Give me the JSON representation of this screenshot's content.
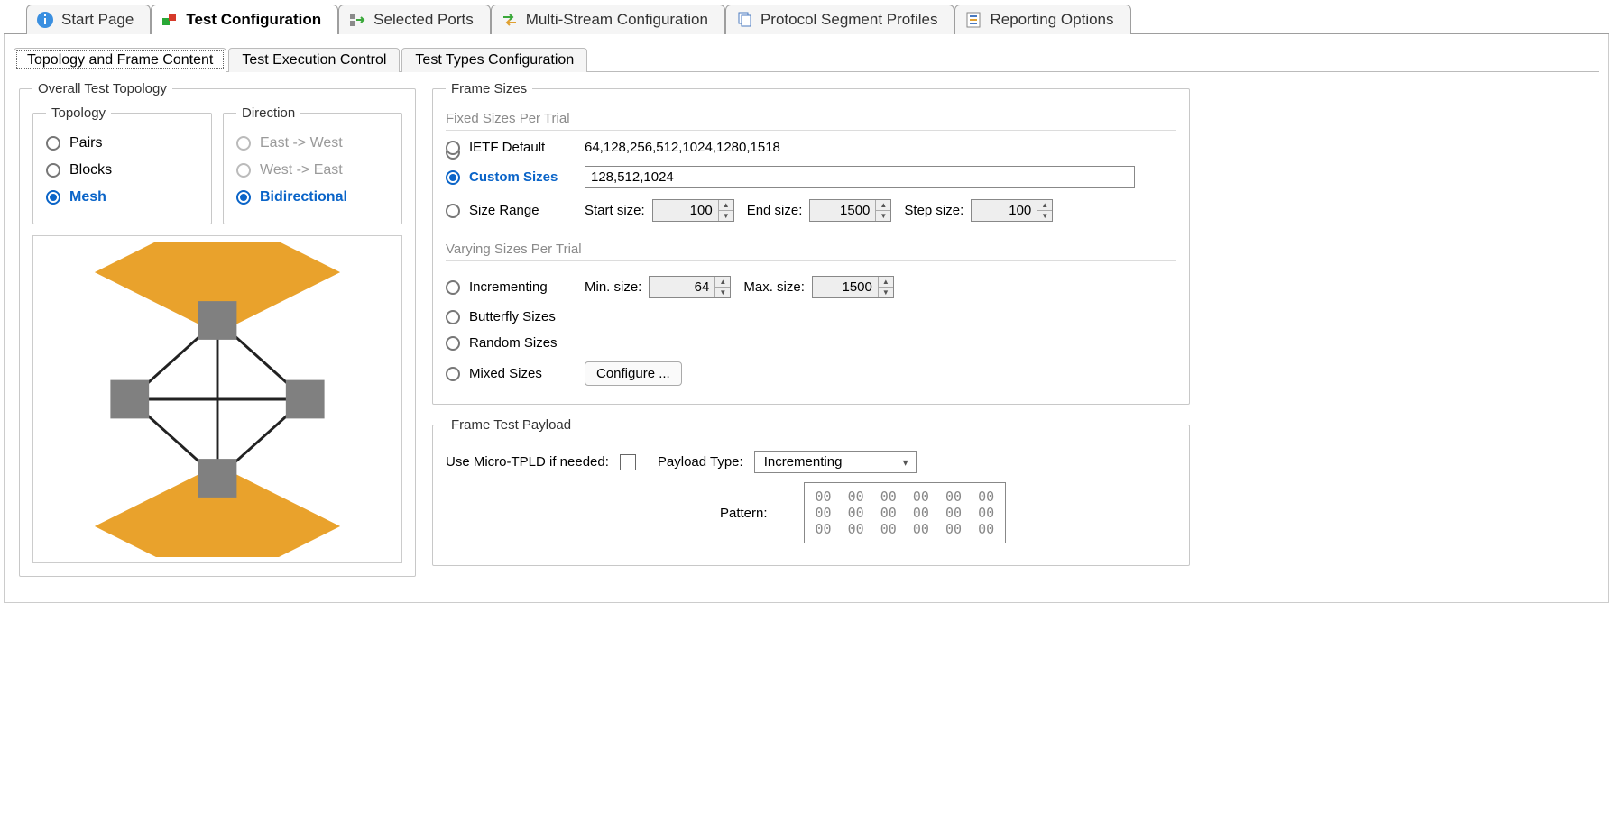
{
  "mainTabs": {
    "start": "Start Page",
    "config": "Test Configuration",
    "ports": "Selected Ports",
    "multi": "Multi-Stream Configuration",
    "segments": "Protocol Segment Profiles",
    "report": "Reporting Options"
  },
  "subTabs": {
    "topology": "Topology and Frame Content",
    "exec": "Test Execution Control",
    "types": "Test Types Configuration"
  },
  "overallTopology": {
    "legend": "Overall Test Topology",
    "topology": {
      "legend": "Topology",
      "pairs": "Pairs",
      "blocks": "Blocks",
      "mesh": "Mesh"
    },
    "direction": {
      "legend": "Direction",
      "ew": "East -> West",
      "we": "West -> East",
      "bidir": "Bidirectional"
    }
  },
  "frameSizes": {
    "legend": "Frame Sizes",
    "fixed": "Fixed Sizes Per Trial",
    "ietf": {
      "label": "IETF Default",
      "value": "64,128,256,512,1024,1280,1518"
    },
    "custom": {
      "label": "Custom Sizes",
      "value": "128,512,1024"
    },
    "range": {
      "label": "Size Range",
      "startLabel": "Start size:",
      "startVal": "100",
      "endLabel": "End size:",
      "endVal": "1500",
      "stepLabel": "Step size:",
      "stepVal": "100"
    },
    "varying": "Varying Sizes Per Trial",
    "inc": {
      "label": "Incrementing",
      "minLabel": "Min. size:",
      "minVal": "64",
      "maxLabel": "Max. size:",
      "maxVal": "1500"
    },
    "butterfly": "Butterfly Sizes",
    "random": "Random Sizes",
    "mixed": {
      "label": "Mixed Sizes",
      "btn": "Configure ..."
    }
  },
  "payload": {
    "legend": "Frame Test Payload",
    "microLbl": "Use Micro-TPLD if needed:",
    "typeLbl": "Payload Type:",
    "typeVal": "Incrementing",
    "patternLbl": "Pattern:",
    "patternVal": "00  00  00  00  00  00\n00  00  00  00  00  00\n00  00  00  00  00  00"
  }
}
